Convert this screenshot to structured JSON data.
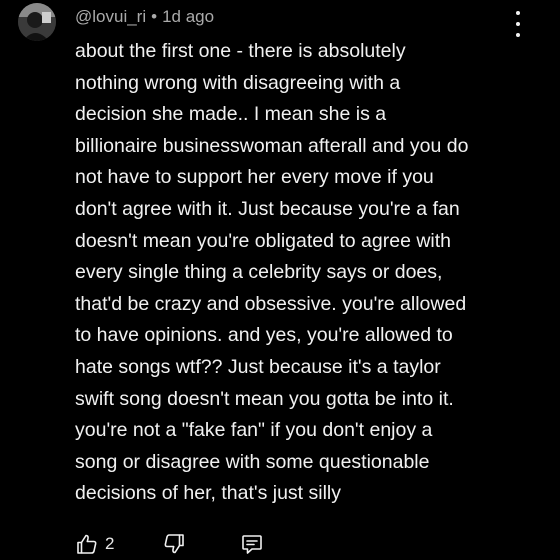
{
  "comment": {
    "author": "@lovui_ri",
    "separator": "•",
    "timestamp": "1d ago",
    "text_lines": [
      "about the first one - there is absolutely",
      "nothing wrong with disagreeing with a",
      "decision she made.. I mean she is a",
      "billionaire businesswoman afterall and you do",
      "not have to support her every move if you",
      "don't agree with it. Just because you're a fan",
      "doesn't mean you're obligated to agree with",
      "every single thing a celebrity says or does,",
      "that'd be crazy and obsessive. you're allowed",
      "to have opinions. and yes, you're allowed to",
      "hate songs wtf?? Just because it's a taylor",
      "swift song doesn't mean you gotta be into it.",
      "you're not a \"fake fan\" if you don't enjoy a",
      "song or disagree with some questionable",
      "decisions of her, that's just silly"
    ]
  },
  "actions": {
    "like_count": "2",
    "like_icon": "thumbs-up-icon",
    "dislike_icon": "thumbs-down-icon",
    "reply_icon": "comment-reply-icon",
    "more_icon": "more-vertical-icon"
  },
  "colors": {
    "background": "#000000",
    "text": "#f1f1f1",
    "meta_text": "#aaaaaa"
  }
}
